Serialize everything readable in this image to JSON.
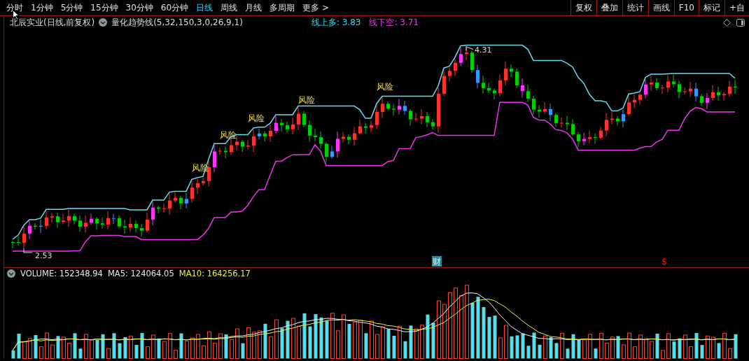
{
  "period_tabs": [
    {
      "label": "分时",
      "selected": false
    },
    {
      "label": "1分钟",
      "selected": false
    },
    {
      "label": "5分钟",
      "selected": false
    },
    {
      "label": "15分钟",
      "selected": false
    },
    {
      "label": "30分钟",
      "selected": false
    },
    {
      "label": "60分钟",
      "selected": false
    },
    {
      "label": "日线",
      "selected": true
    },
    {
      "label": "周线",
      "selected": false
    },
    {
      "label": "月线",
      "selected": false
    },
    {
      "label": "多周期",
      "selected": false
    },
    {
      "label": "更多 >",
      "selected": false
    }
  ],
  "toolbar_buttons": [
    "复权",
    "叠加",
    "统计",
    "画线",
    "F10",
    "标记",
    "+自"
  ],
  "main_panel": {
    "stock_title": "北辰实业(日线,前复权)",
    "indicator": "量化趋势线(5,32,150,3,0,26,9,1)",
    "readouts": [
      {
        "label": "线上多: 3.83",
        "color": "#33ddee"
      },
      {
        "label": "线下空: 3.71",
        "color": "#ee33ee"
      }
    ],
    "high_label": "4.31",
    "low_label": "2.53",
    "signal_labels": [
      "风险",
      "风险",
      "风险",
      "风险",
      "风险"
    ],
    "event_markers": [
      {
        "text": "财",
        "color": "#2a8a9a",
        "kind": "badge"
      },
      {
        "text": "$",
        "color": "#ee2222",
        "kind": "glyph"
      }
    ]
  },
  "volume_panel": {
    "readouts": [
      {
        "label": "VOLUME: 152348.94",
        "color": "#e8e8e8"
      },
      {
        "label": "MA5: 124064.05",
        "color": "#e8e8e8"
      },
      {
        "label": "MA10: 164256.17",
        "color": "#eeee44"
      }
    ]
  }
}
